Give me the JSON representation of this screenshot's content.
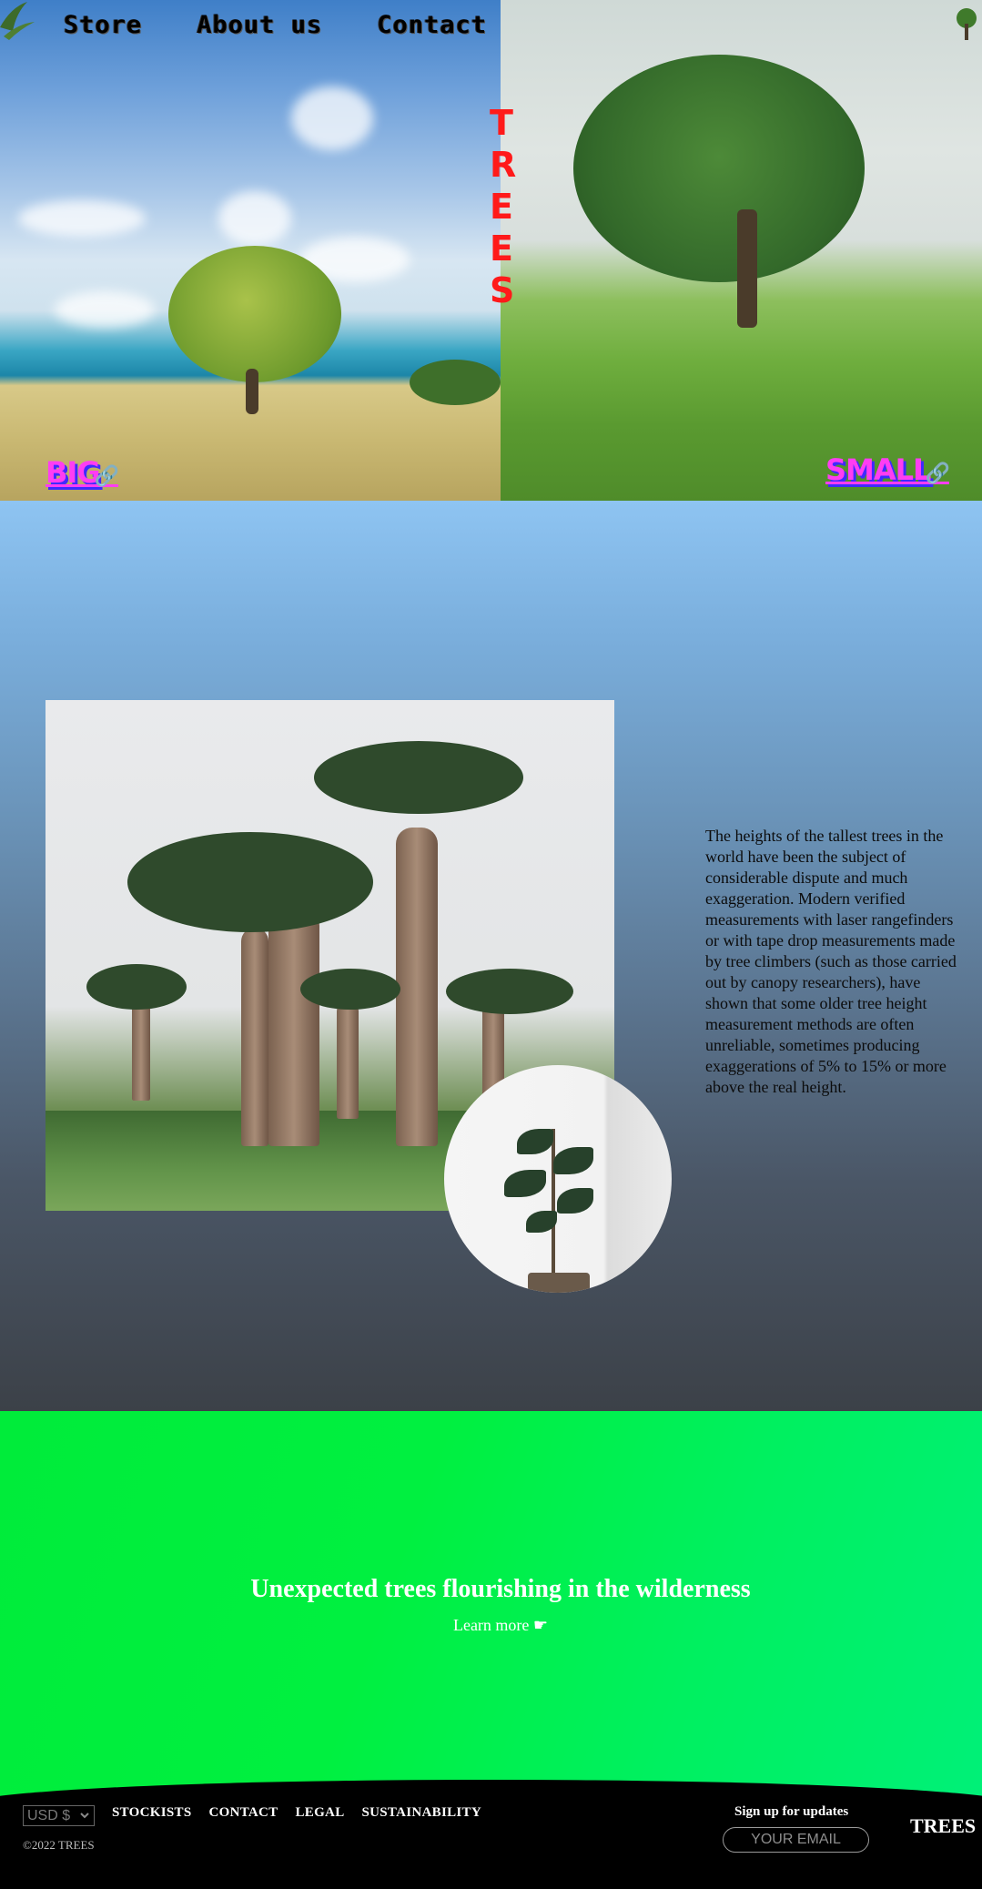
{
  "nav": {
    "items": [
      {
        "label": "Store"
      },
      {
        "label": "About us"
      },
      {
        "label": "Contact"
      }
    ]
  },
  "hero": {
    "brand_vertical": "TREES",
    "left_tag": "BIG",
    "right_tag": "SMALL",
    "link_icon": "link-icon"
  },
  "middle": {
    "paragraph": "The heights of the tallest trees in the world have been the subject of considerable dispute and much exaggeration. Modern verified measurements with laser rangefinders or with tape drop measurements made by tree climbers (such as those carried out by canopy researchers), have shown that some older tree height measurement methods are often unreliable, sometimes producing exaggerations of 5% to 15% or more above the real height."
  },
  "promo": {
    "headline": "Unexpected trees flourishing in the wilderness",
    "learn_more": "Learn more ☛"
  },
  "footer": {
    "currency": "USD $",
    "links": [
      "STOCKISTS",
      "CONTACT",
      "LEGAL",
      "SUSTAINABILITY"
    ],
    "copyright": "©2022 TREES",
    "signup_label": "Sign up for updates",
    "email_placeholder": "YOUR EMAIL",
    "brand": "TREES"
  },
  "colors": {
    "brand_red": "#ff1a1a",
    "tag_magenta": "#ff3df2",
    "tag_shadow": "#3f2aff",
    "promo_green": "#00f040"
  }
}
